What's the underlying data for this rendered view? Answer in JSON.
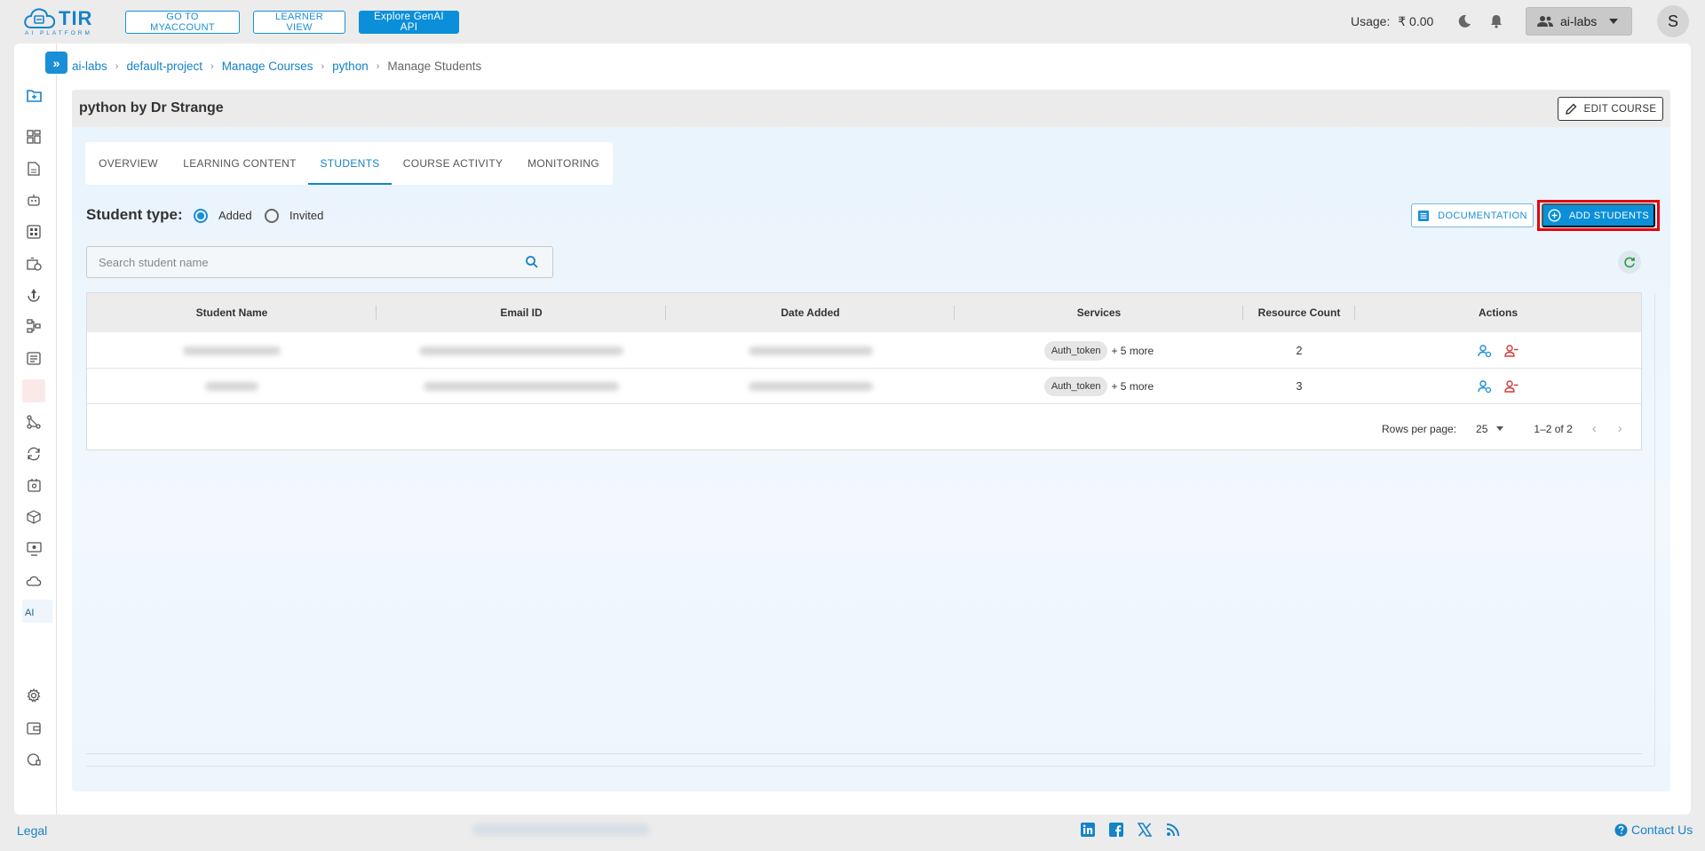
{
  "brand": {
    "name": "TIR",
    "subtitle": "AI PLATFORM"
  },
  "header": {
    "buttons": [
      "GO TO MYACCOUNT",
      "LEARNER VIEW",
      "Explore GenAI API"
    ],
    "usage_label": "Usage:",
    "usage_value": "₹ 0.00",
    "org": "ai-labs",
    "avatar_initial": "S"
  },
  "sidebar": {
    "toggle_glyph": "»",
    "ai_label": "AI"
  },
  "breadcrumb": [
    "ai-labs",
    "default-project",
    "Manage Courses",
    "python",
    "Manage Students"
  ],
  "course": {
    "title": "python by Dr Strange",
    "edit_label": "EDIT COURSE"
  },
  "tabs": [
    "OVERVIEW",
    "LEARNING CONTENT",
    "STUDENTS",
    "COURSE ACTIVITY",
    "MONITORING"
  ],
  "active_tab": "STUDENTS",
  "student_type": {
    "label": "Student type:",
    "options": [
      "Added",
      "Invited"
    ],
    "selected": "Added"
  },
  "actions": {
    "documentation": "DOCUMENTATION",
    "add_students": "ADD STUDENTS"
  },
  "search": {
    "placeholder": "Search student name",
    "value": ""
  },
  "table": {
    "columns": [
      "Student Name",
      "Email ID",
      "Date Added",
      "Services",
      "Resource Count",
      "Actions"
    ],
    "rows": [
      {
        "service_chip": "Auth_token",
        "service_more": "+ 5 more",
        "resource_count": "2"
      },
      {
        "service_chip": "Auth_token",
        "service_more": "+ 5 more",
        "resource_count": "3"
      }
    ]
  },
  "pagination": {
    "rows_per_page_label": "Rows per page:",
    "rows_per_page": "25",
    "range": "1–2 of 2"
  },
  "footer": {
    "legal": "Legal",
    "contact": "Contact Us"
  },
  "colors": {
    "accent": "#1583c8",
    "primary_button": "#0a8fd8",
    "highlight": "#e3000f",
    "danger_icon": "#d23b3b"
  }
}
